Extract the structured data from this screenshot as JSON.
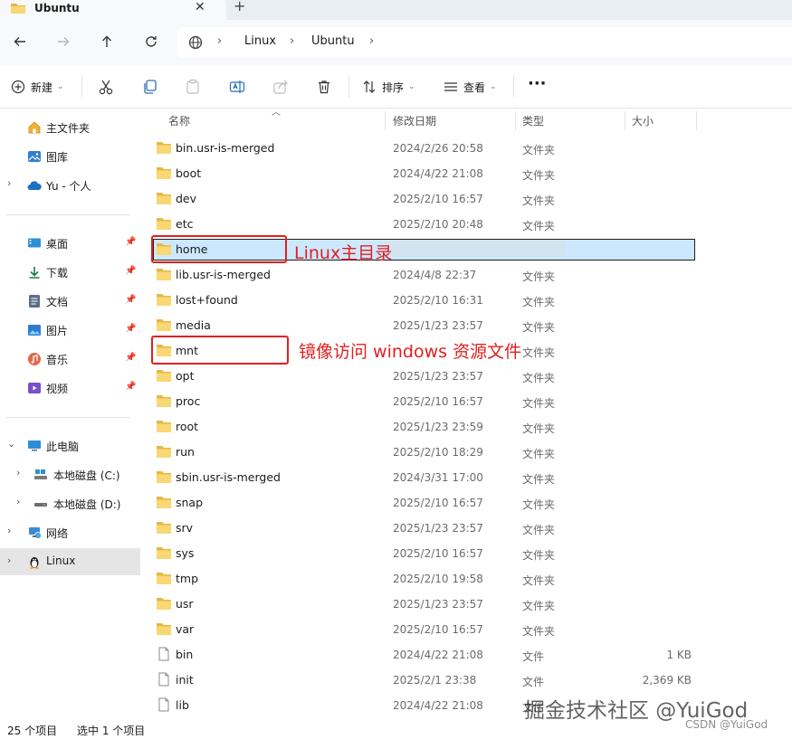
{
  "window": {
    "tab_title": "Ubuntu",
    "tab_close": "✕",
    "new_tab": "+"
  },
  "nav": {
    "breadcrumbs": [
      "Linux",
      "Ubuntu"
    ],
    "sep": "›"
  },
  "toolbar": {
    "new_label": "新建",
    "sort_label": "排序",
    "view_label": "查看",
    "more": "···"
  },
  "sidebar": {
    "items": [
      {
        "label": "主文件夹",
        "icon": "home-icon"
      },
      {
        "label": "图库",
        "icon": "gallery-icon"
      },
      {
        "label": "Yu - 个人",
        "icon": "onedrive-icon"
      },
      {
        "label": "桌面",
        "icon": "desktop-icon"
      },
      {
        "label": "下载",
        "icon": "download-icon"
      },
      {
        "label": "文档",
        "icon": "documents-icon"
      },
      {
        "label": "图片",
        "icon": "pictures-icon"
      },
      {
        "label": "音乐",
        "icon": "music-icon"
      },
      {
        "label": "视频",
        "icon": "videos-icon"
      },
      {
        "label": "此电脑",
        "icon": "this-pc-icon"
      },
      {
        "label": "本地磁盘 (C:)",
        "icon": "drive-c-icon"
      },
      {
        "label": "本地磁盘 (D:)",
        "icon": "drive-d-icon"
      },
      {
        "label": "网络",
        "icon": "network-icon"
      },
      {
        "label": "Linux",
        "icon": "linux-icon"
      }
    ]
  },
  "columns": {
    "name": "名称",
    "modified": "修改日期",
    "type": "类型",
    "size": "大小"
  },
  "files": [
    {
      "name": "bin.usr-is-merged",
      "date": "2024/2/26 20:58",
      "type": "文件夹",
      "size": "",
      "kind": "folder"
    },
    {
      "name": "boot",
      "date": "2024/4/22 21:08",
      "type": "文件夹",
      "size": "",
      "kind": "folder"
    },
    {
      "name": "dev",
      "date": "2025/2/10 16:57",
      "type": "文件夹",
      "size": "",
      "kind": "folder"
    },
    {
      "name": "etc",
      "date": "2025/2/10 20:48",
      "type": "文件夹",
      "size": "",
      "kind": "folder"
    },
    {
      "name": "home",
      "date": "",
      "type": "",
      "size": "",
      "kind": "folder"
    },
    {
      "name": "lib.usr-is-merged",
      "date": "2024/4/8 22:37",
      "type": "文件夹",
      "size": "",
      "kind": "folder"
    },
    {
      "name": "lost+found",
      "date": "2025/2/10 16:31",
      "type": "文件夹",
      "size": "",
      "kind": "folder"
    },
    {
      "name": "media",
      "date": "2025/1/23 23:57",
      "type": "文件夹",
      "size": "",
      "kind": "folder"
    },
    {
      "name": "mnt",
      "date": "",
      "type": "文件夹",
      "size": "",
      "kind": "folder"
    },
    {
      "name": "opt",
      "date": "2025/1/23 23:57",
      "type": "文件夹",
      "size": "",
      "kind": "folder"
    },
    {
      "name": "proc",
      "date": "2025/2/10 16:57",
      "type": "文件夹",
      "size": "",
      "kind": "folder"
    },
    {
      "name": "root",
      "date": "2025/1/23 23:59",
      "type": "文件夹",
      "size": "",
      "kind": "folder"
    },
    {
      "name": "run",
      "date": "2025/2/10 18:29",
      "type": "文件夹",
      "size": "",
      "kind": "folder"
    },
    {
      "name": "sbin.usr-is-merged",
      "date": "2024/3/31 17:00",
      "type": "文件夹",
      "size": "",
      "kind": "folder"
    },
    {
      "name": "snap",
      "date": "2025/2/10 16:57",
      "type": "文件夹",
      "size": "",
      "kind": "folder"
    },
    {
      "name": "srv",
      "date": "2025/1/23 23:57",
      "type": "文件夹",
      "size": "",
      "kind": "folder"
    },
    {
      "name": "sys",
      "date": "2025/2/10 16:57",
      "type": "文件夹",
      "size": "",
      "kind": "folder"
    },
    {
      "name": "tmp",
      "date": "2025/2/10 19:58",
      "type": "文件夹",
      "size": "",
      "kind": "folder"
    },
    {
      "name": "usr",
      "date": "2025/1/23 23:57",
      "type": "文件夹",
      "size": "",
      "kind": "folder"
    },
    {
      "name": "var",
      "date": "2025/2/10 16:57",
      "type": "文件夹",
      "size": "",
      "kind": "folder"
    },
    {
      "name": "bin",
      "date": "2024/4/22 21:08",
      "type": "文件",
      "size": "1 KB",
      "kind": "file"
    },
    {
      "name": "init",
      "date": "2025/2/1 23:38",
      "type": "文件",
      "size": "2,369 KB",
      "kind": "file"
    },
    {
      "name": "lib",
      "date": "2024/4/22 21:08",
      "type": "文件",
      "size": "",
      "kind": "file"
    }
  ],
  "annotations": {
    "home_note": "Linux主目录",
    "mnt_note": "镜像访问 windows 资源文件"
  },
  "status": {
    "item_count": "25 个项目",
    "selection": "选中 1 个项目"
  },
  "watermark": {
    "main": "掘金技术社区 @YuiGod",
    "csdn": "CSDN @YuiGod"
  },
  "colors": {
    "selection": "#cce8ff",
    "annotation": "#e02020",
    "folder": "#f8d775",
    "accent": "#0067c0"
  }
}
